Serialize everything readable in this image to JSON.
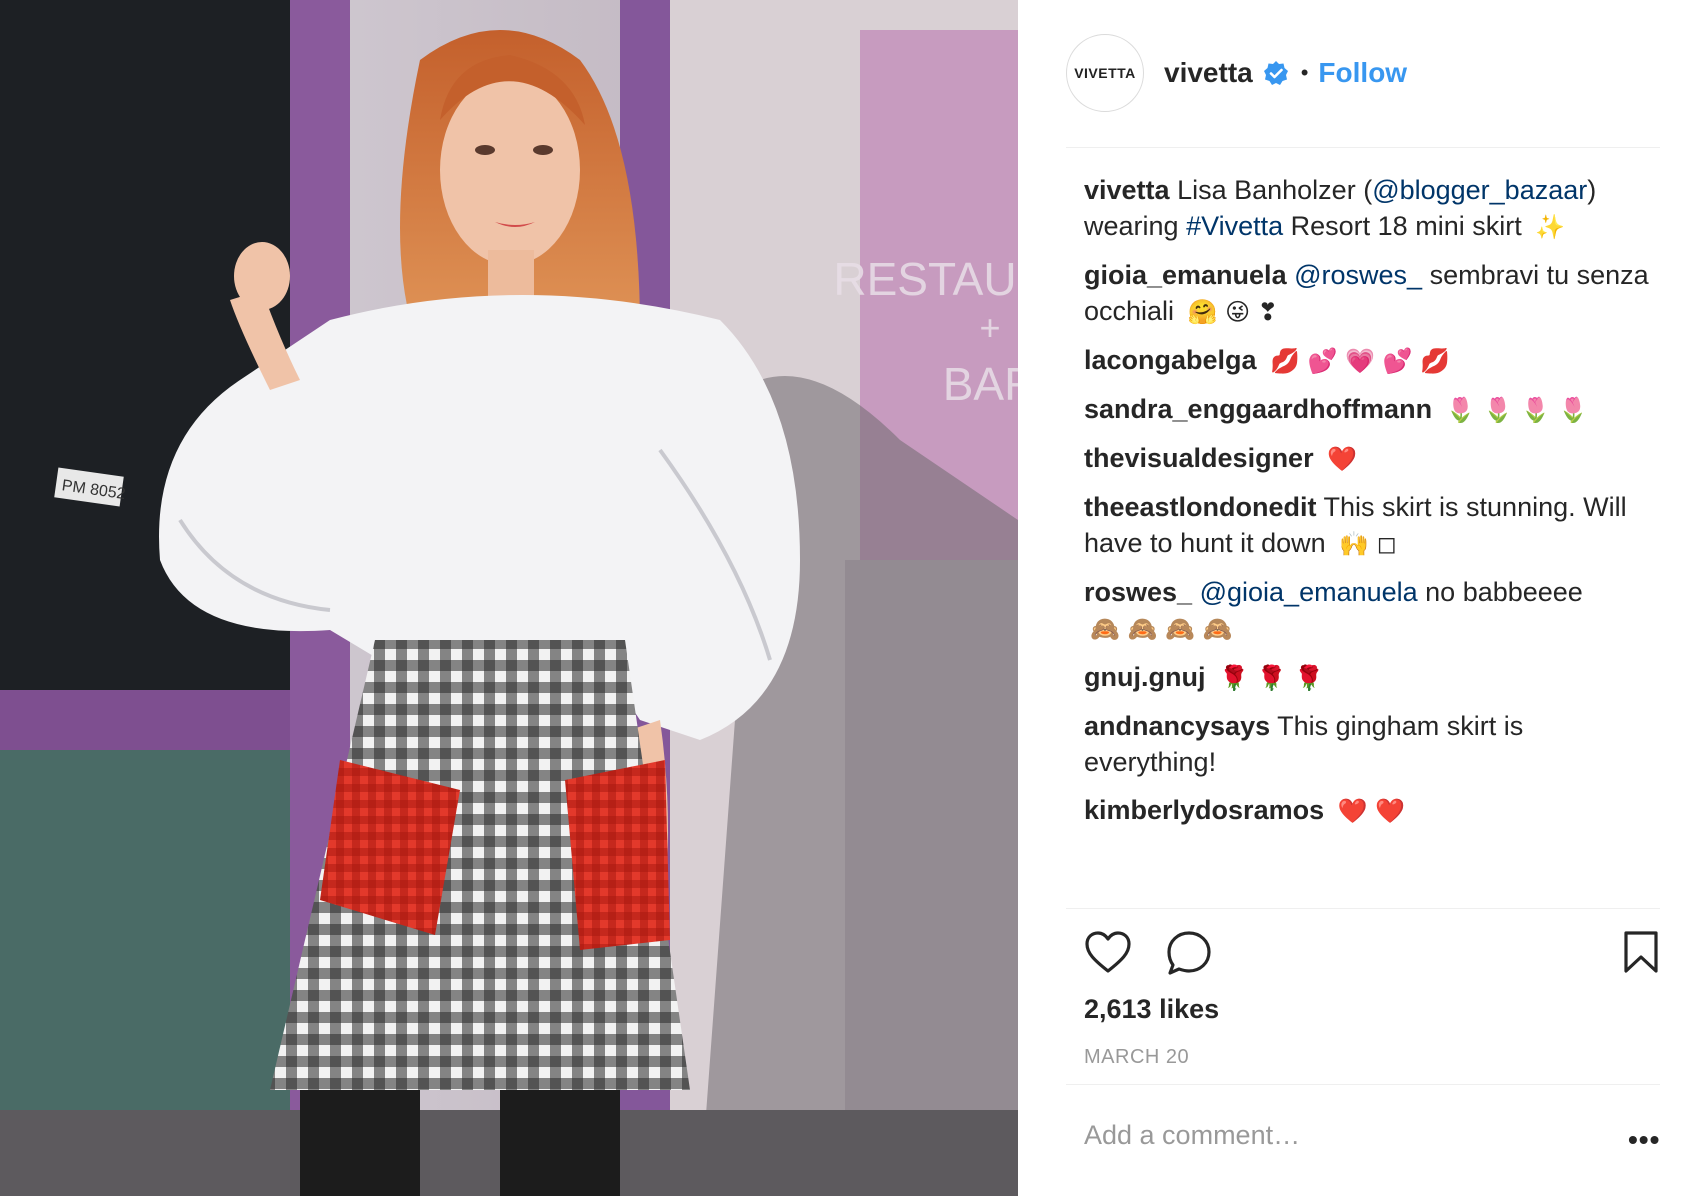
{
  "header": {
    "avatar_text": "VIVETTA",
    "username": "vivetta",
    "separator": "•",
    "follow_label": "Follow"
  },
  "photo": {
    "sign_text": [
      "RESTAU",
      "+",
      "BAR"
    ],
    "plate_text": "PM 8052"
  },
  "caption": {
    "user": "vivetta",
    "parts": [
      "Lisa Banholzer (",
      "@blogger_bazaar",
      ")",
      " wearing ",
      "#Vivetta",
      " Resort 18 mini skirt"
    ],
    "emoji": "✨"
  },
  "comments": [
    {
      "user": "gioia_emanuela",
      "mention": "@roswes_",
      "text": " sembravi tu senza occhiali",
      "emoji": "🤗 😜 ❣"
    },
    {
      "user": "lacongabelga",
      "text": "",
      "emoji": "💋 💕 💗 💕 💋"
    },
    {
      "user": "sandra_enggaardhoffmann",
      "text": "",
      "emoji": "🌷 🌷 🌷 🌷"
    },
    {
      "user": "thevisualdesigner",
      "text": "",
      "emoji": "❤️"
    },
    {
      "user": "theeastlondonedit",
      "text": "This skirt is stunning. Will have to hunt it down",
      "emoji": "🙌 ◻"
    },
    {
      "user": "roswes_",
      "mention": "@gioia_emanuela",
      "text": " no babbeeee",
      "emoji": "🙈 🙈 🙈 🙈"
    },
    {
      "user": "gnuj.gnuj",
      "text": "",
      "emoji": "🌹 🌹 🌹"
    },
    {
      "user": "andnancysays",
      "text": "This gingham skirt is everything!",
      "emoji": ""
    },
    {
      "user": "kimberlydosramos",
      "text": "",
      "emoji": "❤️ ❤️"
    }
  ],
  "actions": {
    "like_icon": "heart-icon",
    "comment_icon": "comment-bubble-icon",
    "save_icon": "bookmark-icon"
  },
  "likes_text": "2,613 likes",
  "date_text": "MARCH 20",
  "add_comment_placeholder": "Add a comment…",
  "more_label": "•••",
  "colors": {
    "follow": "#3897f0",
    "link": "#003569",
    "verified": "#3897f0",
    "muted": "#999999"
  }
}
